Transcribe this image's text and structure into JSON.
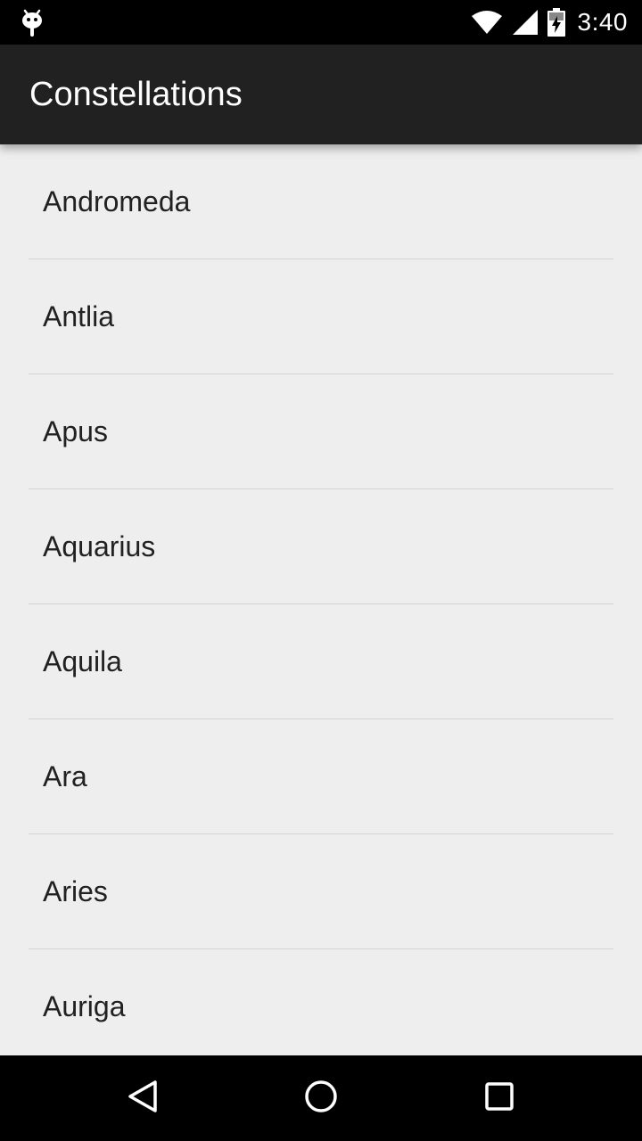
{
  "status_bar": {
    "time": "3:40",
    "icons": [
      "android-debug-icon",
      "wifi-icon",
      "cell-signal-icon",
      "battery-charging-icon"
    ]
  },
  "app_bar": {
    "title": "Constellations",
    "background": "#212121"
  },
  "list": {
    "background": "#eeeeee",
    "items": [
      {
        "label": "Andromeda"
      },
      {
        "label": "Antlia"
      },
      {
        "label": "Apus"
      },
      {
        "label": "Aquarius"
      },
      {
        "label": "Aquila"
      },
      {
        "label": "Ara"
      },
      {
        "label": "Aries"
      },
      {
        "label": "Auriga"
      }
    ]
  },
  "nav_bar": {
    "buttons": [
      "back-icon",
      "home-icon",
      "recents-icon"
    ]
  }
}
